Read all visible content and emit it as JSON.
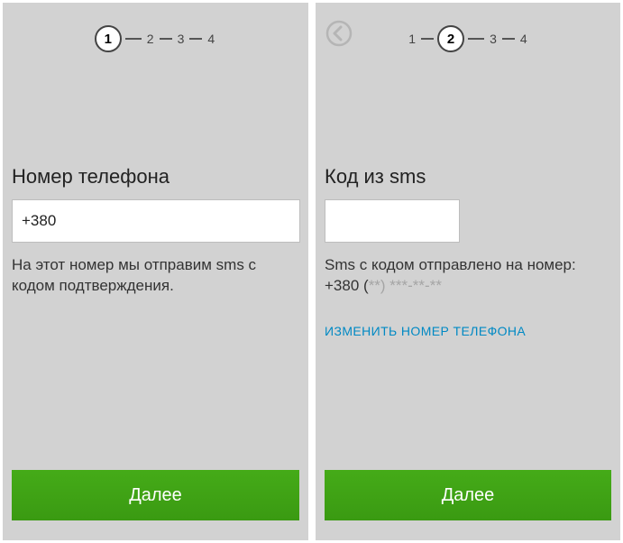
{
  "stepper": {
    "totalSteps": 4,
    "labels": [
      "1",
      "2",
      "3",
      "4"
    ]
  },
  "screen1": {
    "currentStep": 1,
    "heading": "Номер телефона",
    "phoneValue": "+380",
    "helper": "На этот номер мы отправим sms с кодом подтверждения.",
    "nextLabel": "Далее"
  },
  "screen2": {
    "currentStep": 2,
    "heading": "Код из sms",
    "codeValue": "",
    "helperPrefix": "Sms с кодом отправлено на номер:",
    "phoneDisplayPrefix": "+380 (",
    "phoneMasked": "**) ***-**-**",
    "changeLink": "ИЗМЕНИТЬ НОМЕР ТЕЛЕФОНА",
    "nextLabel": "Далее",
    "backIcon": "arrow-left-circle"
  },
  "colors": {
    "primary": "#3ea116",
    "link": "#0089c4",
    "panelBg": "#d2d2d2"
  }
}
